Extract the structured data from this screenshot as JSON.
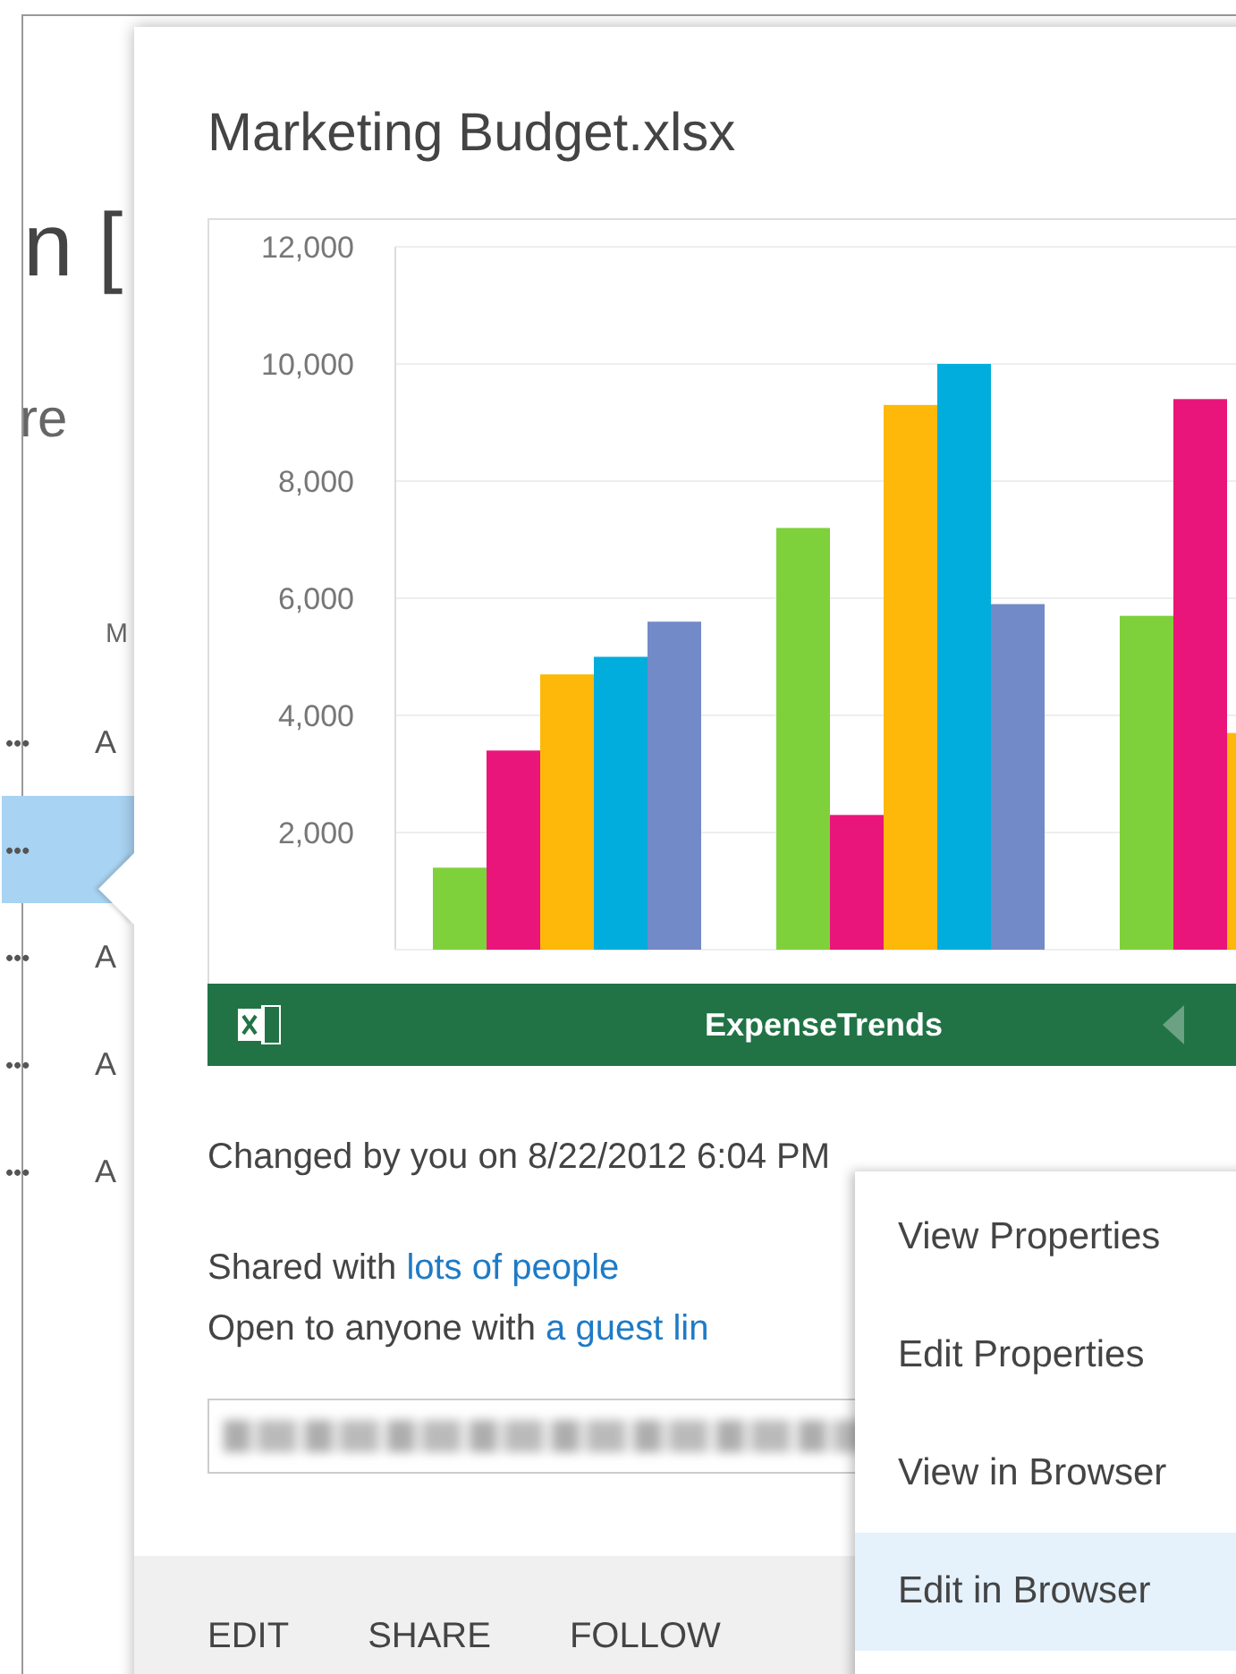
{
  "background": {
    "heading_fragment": "n [",
    "subheading_fragment": "re",
    "column_fragment": "M",
    "rows": [
      {
        "more": "•••",
        "fragment": "A",
        "selected": false
      },
      {
        "more": "•••",
        "fragment": "",
        "selected": true
      },
      {
        "more": "•••",
        "fragment": "A",
        "selected": false
      },
      {
        "more": "•••",
        "fragment": "A",
        "selected": false
      },
      {
        "more": "•••",
        "fragment": "A",
        "selected": false
      }
    ]
  },
  "card": {
    "title": "Marketing Budget.xlsx",
    "chart_data": {
      "type": "bar",
      "grid": true,
      "ylim": [
        0,
        12000
      ],
      "yticks": [
        {
          "value": 2000,
          "label": "2,000"
        },
        {
          "value": 4000,
          "label": "4,000"
        },
        {
          "value": 6000,
          "label": "6,000"
        },
        {
          "value": 8000,
          "label": "8,000"
        },
        {
          "value": 10000,
          "label": "10,000"
        },
        {
          "value": 12000,
          "label": "12,000"
        }
      ],
      "series": [
        {
          "color": "#7fd13b",
          "values": [
            1400,
            7200,
            5700
          ]
        },
        {
          "color": "#ea157a",
          "values": [
            3400,
            2300,
            9400
          ]
        },
        {
          "color": "#feb80a",
          "values": [
            4700,
            9300,
            3700
          ]
        },
        {
          "color": "#00addc",
          "values": [
            5000,
            10000,
            null
          ]
        },
        {
          "color": "#738ac8",
          "values": [
            5600,
            5900,
            null
          ]
        }
      ]
    },
    "sheet_name": "ExpenseTrends",
    "changed": "Changed by you on 8/22/2012 6:04 PM",
    "shared_prefix": "Shared with",
    "shared_link": "lots of people",
    "open_prefix": "Open to anyone with",
    "open_link": "a guest lin",
    "actions": [
      "EDIT",
      "SHARE",
      "FOLLOW"
    ]
  },
  "menu": {
    "items": [
      {
        "label": "View Properties",
        "selected": false
      },
      {
        "label": "Edit Properties",
        "selected": false
      },
      {
        "label": "View in Browser",
        "selected": false
      },
      {
        "label": "Edit in Browser",
        "selected": true
      }
    ]
  }
}
